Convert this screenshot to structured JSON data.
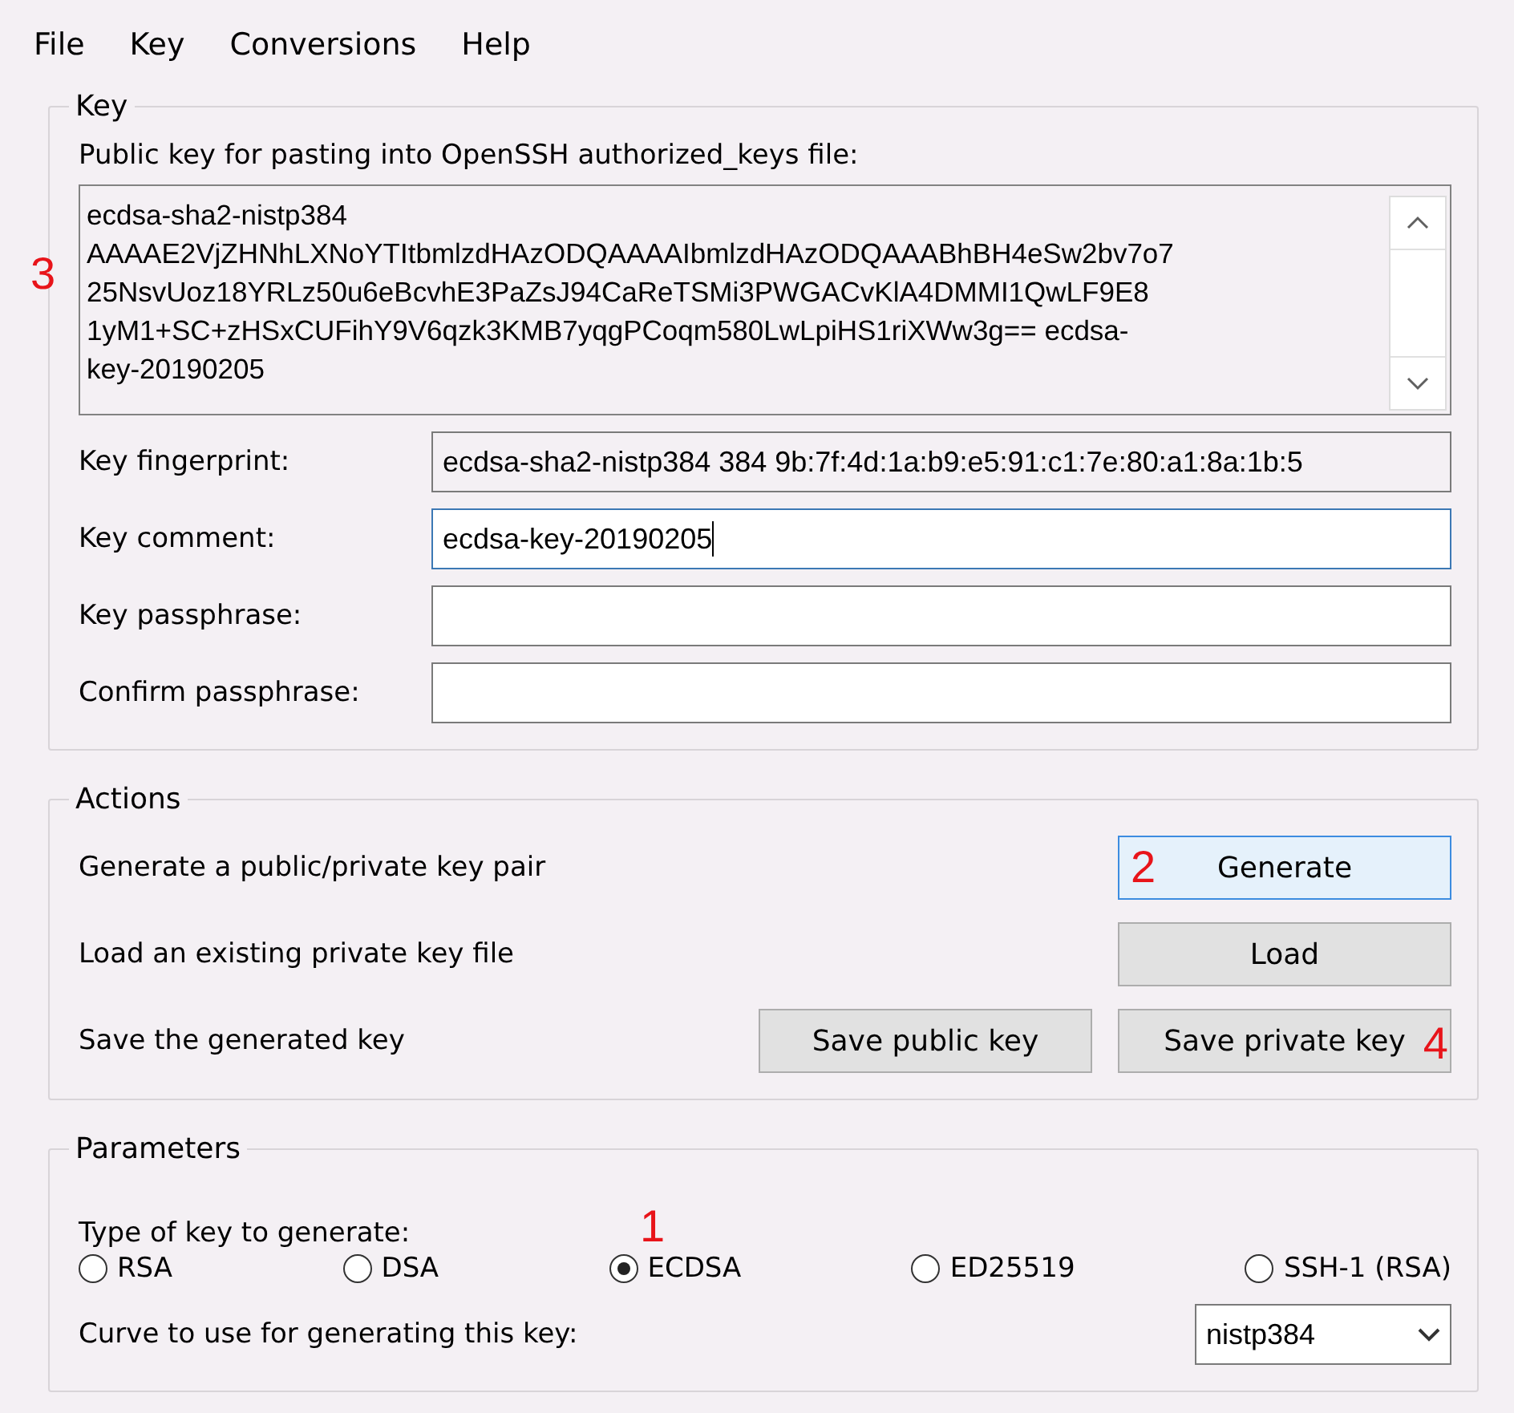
{
  "menu": [
    {
      "label": "File"
    },
    {
      "label": "Key"
    },
    {
      "label": "Conversions"
    },
    {
      "label": "Help"
    }
  ],
  "key_group": {
    "title": "Key",
    "public_key_label": "Public key for pasting into OpenSSH authorized_keys file:",
    "public_key_lines": [
      "ecdsa-sha2-nistp384",
      "AAAAE2VjZHNhLXNoYTItbmlzdHAzODQAAAAIbmlzdHAzODQAAABhBH4eSw2bv7o7",
      "25NsvUoz18YRLz50u6eBcvhE3PaZsJ94CaReTSMi3PWGACvKlA4DMMI1QwLF9E8",
      "1yM1+SC+zHSxCUFihY9V6qzk3KMB7yqgPCoqm580LwLpiHS1riXWw3g== ecdsa-",
      "key-20190205"
    ],
    "fields": [
      {
        "label": "Key fingerprint:",
        "value": "ecdsa-sha2-nistp384 384 9b:7f:4d:1a:b9:e5:91:c1:7e:80:a1:8a:1b:5",
        "disabled": true,
        "focused": false
      },
      {
        "label": "Key comment:",
        "value": "ecdsa-key-20190205",
        "disabled": false,
        "focused": true
      },
      {
        "label": "Key passphrase:",
        "disabled": false,
        "focused": false
      },
      {
        "label": "Confirm passphrase:",
        "disabled": false,
        "focused": false
      }
    ],
    "public_key_annotation": "3"
  },
  "actions_group": {
    "title": "Actions",
    "rows": [
      {
        "text": "Generate a public/private key pair",
        "buttons": [
          {
            "label": "Generate",
            "focused": true,
            "annotation": "2"
          }
        ]
      },
      {
        "text": "Load an existing private key file",
        "buttons": [
          {
            "label": "Load",
            "focused": false
          }
        ]
      },
      {
        "text": "Save the generated key",
        "buttons": [
          {
            "label": "Save public key",
            "focused": false
          },
          {
            "label": "Save private key",
            "focused": false,
            "annotation": "4"
          }
        ]
      }
    ]
  },
  "parameters_group": {
    "title": "Parameters",
    "type_label": "Type of key to generate:",
    "key_types": [
      {
        "label": "RSA",
        "selected": false
      },
      {
        "label": "DSA",
        "selected": false
      },
      {
        "label": "ECDSA",
        "selected": true
      },
      {
        "label": "ED25519",
        "selected": false
      },
      {
        "label": "SSH-1 (RSA)",
        "selected": false
      }
    ],
    "curve_label": "Curve to use for generating this key:",
    "curve_value": "nistp384",
    "annotation": "1"
  }
}
